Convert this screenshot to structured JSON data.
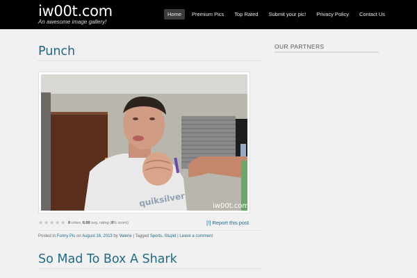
{
  "site": {
    "title": "iw00t.com",
    "tagline": "An awesome image gallery!"
  },
  "nav": {
    "items": [
      {
        "label": "Home",
        "active": true
      },
      {
        "label": "Premium Pics"
      },
      {
        "label": "Top Rated"
      },
      {
        "label": "Submit your pic!"
      },
      {
        "label": "Privacy Policy"
      },
      {
        "label": "Contact Us"
      }
    ]
  },
  "post": {
    "title": "Punch",
    "image_watermark": "iw00t.com",
    "shirt_text": "quiksilver",
    "rating": {
      "stars": 0,
      "votes_label": "0 votes, 0.00 avg. rating (0% score)",
      "votes": "0",
      "votes_suffix": " votes, ",
      "avg": "0.00",
      "avg_suffix": " avg. rating (",
      "score": "0",
      "score_suffix": "% score)"
    },
    "report_label": "[!] Report this post",
    "meta": {
      "posted_in": "Posted in ",
      "category": "Funny Pic",
      "on": " on ",
      "date": "August 16, 2013",
      "by": " by ",
      "author": "Valerie",
      "tagged": " | Tagged ",
      "tag1": "Sports",
      "comma": ", ",
      "tag2": "Stupid",
      "sep": " | ",
      "comment": "Leave a comment"
    }
  },
  "post2": {
    "title": "So Mad To Box A Shark"
  },
  "sidebar": {
    "widget_title": "OUR PARTNERS"
  },
  "colors": {
    "header_bg": "#000000",
    "link": "#1e6a86",
    "page_bg": "#f1f1f1"
  }
}
